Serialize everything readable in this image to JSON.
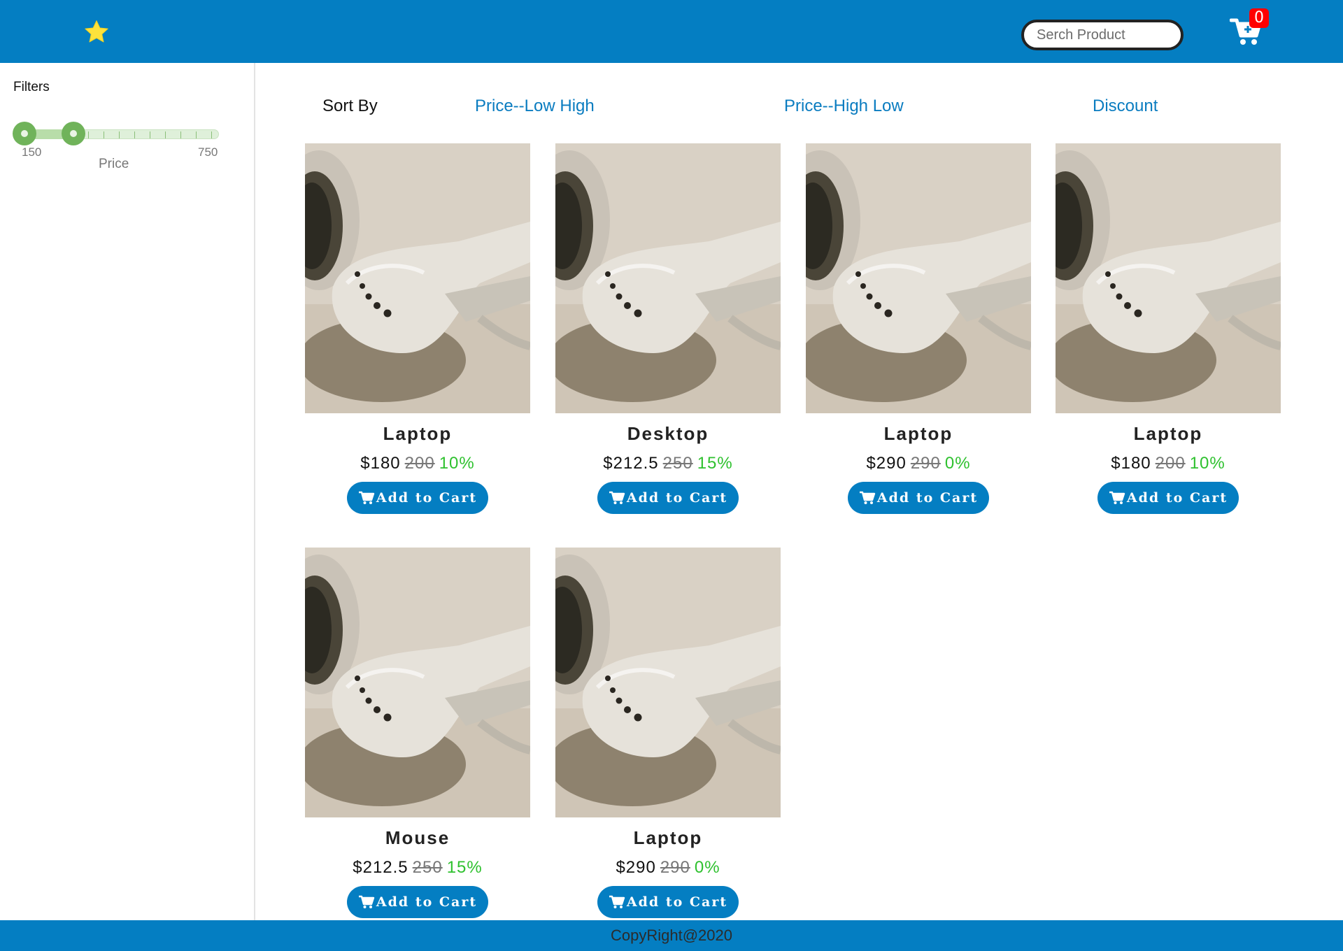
{
  "header": {
    "logo_icon": "star-icon",
    "search_placeholder": "Serch Product",
    "cart_icon": "shopping-cart-icon",
    "cart_count": "0",
    "brand_color": "#047ec2"
  },
  "sidebar": {
    "title": "Filters",
    "price_slider": {
      "label": "Price",
      "min_label": "150",
      "max_label": "750",
      "min_value": 150,
      "max_value": 750,
      "selected_low": 150,
      "selected_high": 300
    }
  },
  "sort": {
    "label": "Sort By",
    "options": [
      "Price--Low High",
      "Price--High Low",
      "Discount"
    ]
  },
  "products": [
    {
      "name": "Laptop",
      "price": "$180",
      "old_price": "200",
      "discount": "10%",
      "button": "Add to Cart"
    },
    {
      "name": "Desktop",
      "price": "$212.5",
      "old_price": "250",
      "discount": "15%",
      "button": "Add to Cart"
    },
    {
      "name": "Laptop",
      "price": "$290",
      "old_price": "290",
      "discount": "0%",
      "button": "Add to Cart"
    },
    {
      "name": "Laptop",
      "price": "$180",
      "old_price": "200",
      "discount": "10%",
      "button": "Add to Cart"
    },
    {
      "name": "Mouse",
      "price": "$212.5",
      "old_price": "250",
      "discount": "15%",
      "button": "Add to Cart"
    },
    {
      "name": "Laptop",
      "price": "$290",
      "old_price": "290",
      "discount": "0%",
      "button": "Add to Cart"
    }
  ],
  "footer": {
    "text": "CopyRight@2020"
  }
}
